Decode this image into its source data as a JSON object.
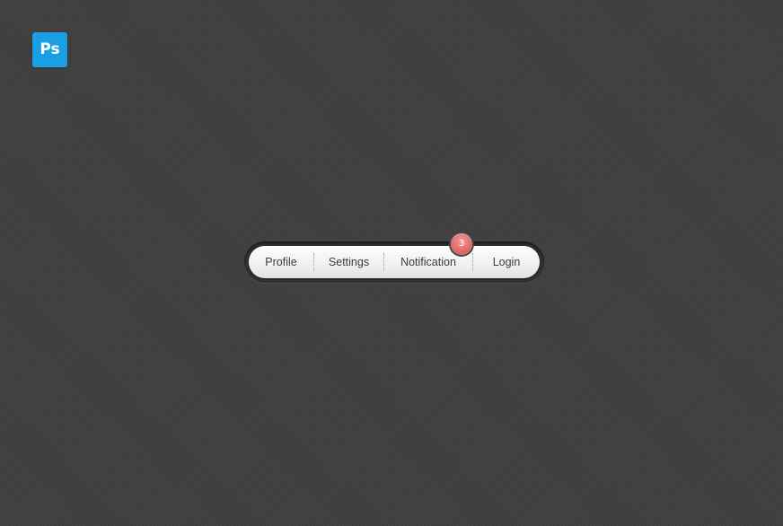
{
  "app": {
    "logo_text": "Ps",
    "logo_color": "#1aa0e2"
  },
  "nav": {
    "items": [
      {
        "label": "Profile"
      },
      {
        "label": "Settings"
      },
      {
        "label": "Notification"
      },
      {
        "label": "Login"
      }
    ],
    "notification_count": "3",
    "badge_color": "#e06a6a"
  }
}
